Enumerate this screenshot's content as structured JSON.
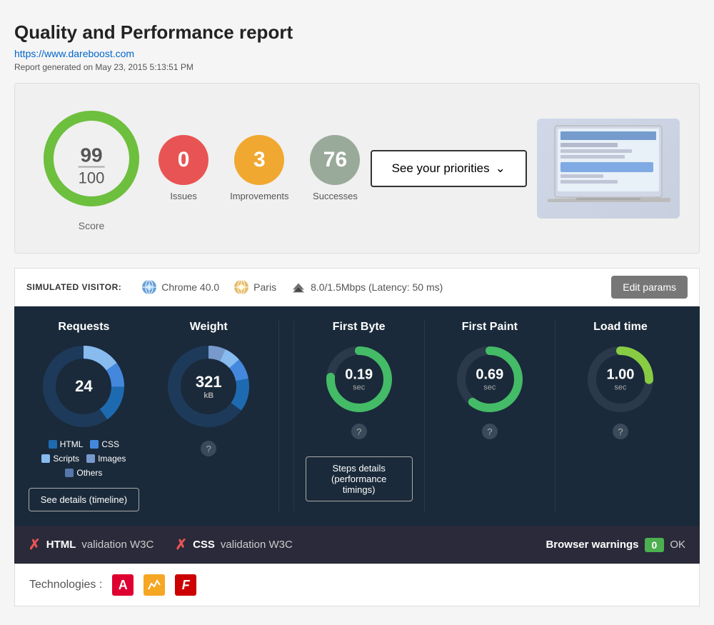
{
  "header": {
    "title": "Quality and Performance report",
    "url": "https://www.dareboost.com",
    "report_date": "Report generated on May 23, 2015 5:13:51 PM"
  },
  "score": {
    "numerator": "99",
    "denominator": "100",
    "label": "Score"
  },
  "issues": {
    "count": "0",
    "label": "Issues",
    "color": "#e85454"
  },
  "improvements": {
    "count": "3",
    "label": "Improvements",
    "color": "#f0a830"
  },
  "successes": {
    "count": "76",
    "label": "Successes",
    "color": "#9aaa9a"
  },
  "priorities_button": "See your priorities",
  "simulated": {
    "label": "SIMULATED VISITOR:",
    "browser": "Chrome 40.0",
    "location": "Paris",
    "network": "8.0/1.5Mbps (Latency: 50 ms)",
    "edit_label": "Edit params"
  },
  "metrics": {
    "requests": {
      "title": "Requests",
      "value": "24"
    },
    "weight": {
      "title": "Weight",
      "value": "321",
      "unit": "kB"
    },
    "first_byte": {
      "title": "First Byte",
      "value": "0.19",
      "unit": "sec"
    },
    "first_paint": {
      "title": "First Paint",
      "value": "0.69",
      "unit": "sec"
    },
    "load_time": {
      "title": "Load time",
      "value": "1.00",
      "unit": "sec"
    },
    "legend": {
      "html": "HTML",
      "css": "CSS",
      "scripts": "Scripts",
      "images": "Images",
      "others": "Others"
    },
    "timeline_btn": "See details (timeline)",
    "steps_btn": "Steps details (performance timings)"
  },
  "validation": {
    "html_label": "HTML",
    "html_suffix": "validation W3C",
    "css_label": "CSS",
    "css_suffix": "validation W3C",
    "browser_warnings": "Browser warnings",
    "ok_count": "0",
    "ok": "OK"
  },
  "technologies": {
    "label": "Technologies :"
  }
}
